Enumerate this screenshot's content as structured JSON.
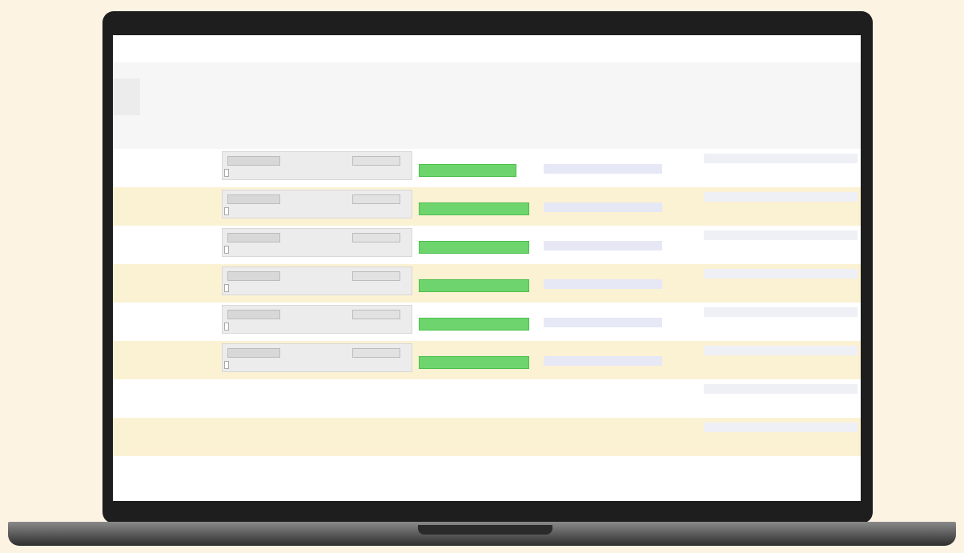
{
  "page": {
    "crumb": "",
    "title": ""
  },
  "info": {
    "side_label": "",
    "line1": "",
    "line2": ""
  },
  "table": {
    "headers": [
      "",
      "",
      "",
      "",
      "",
      ""
    ],
    "rows": [
      {
        "id": "",
        "time": "",
        "type": "",
        "status_count": "",
        "detail": "",
        "reference": ""
      },
      {
        "id": "",
        "time": "",
        "type": "",
        "status_count": "",
        "detail": "",
        "reference": ""
      },
      {
        "id": "",
        "time": "",
        "type": "",
        "status_count": "",
        "detail": "",
        "reference": ""
      },
      {
        "id": "",
        "time": "",
        "type": "",
        "status_count": "",
        "detail": "",
        "reference": ""
      },
      {
        "id": "",
        "time": "",
        "type": "",
        "status_count": "",
        "detail": "",
        "reference": ""
      },
      {
        "id": "",
        "time": "",
        "type": "",
        "status_count": "",
        "detail": "",
        "reference": ""
      },
      {
        "id": "",
        "time": "",
        "reference": ""
      },
      {
        "id": "",
        "time": "",
        "reference": ""
      }
    ]
  },
  "colors": {
    "page_background": "#fdf3e3",
    "link": "#2a52be",
    "row_stripe": "#fbf1d3",
    "status_green": "#6ed56e"
  }
}
